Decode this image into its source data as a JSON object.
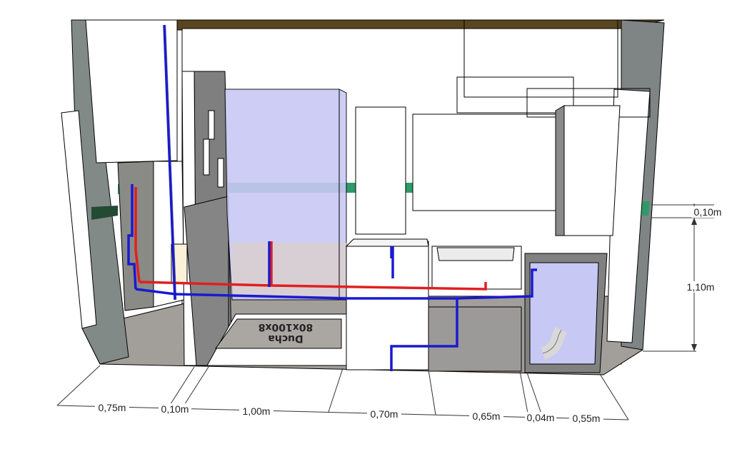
{
  "shower_label": {
    "line1": "Ducha",
    "line2": "80x100x8"
  },
  "dimensions": {
    "bottom": [
      "0,75m",
      "0,10m",
      "1,00m",
      "0,70m",
      "0,65m",
      "0,04m",
      "0,55m"
    ],
    "right_top": "0,10m",
    "right_height": "1,10m"
  },
  "colors": {
    "hot_pipe": "#e02020",
    "cold_pipe": "#1a1ad0",
    "shower_glass": "#c8c8f4",
    "tile_band": "#2e9a6a"
  }
}
